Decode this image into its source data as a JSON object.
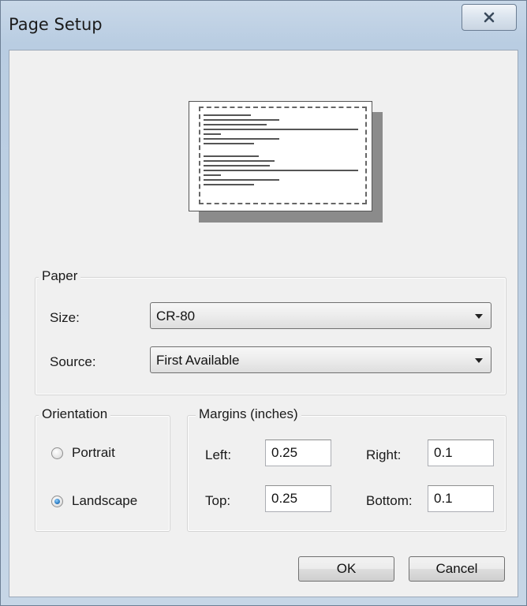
{
  "window": {
    "title": "Page Setup",
    "close_glyph": "X"
  },
  "paper": {
    "legend": "Paper",
    "size_label": "Size:",
    "size_value": "CR-80",
    "source_label": "Source:",
    "source_value": "First Available"
  },
  "orientation": {
    "legend": "Orientation",
    "options": [
      {
        "label": "Portrait",
        "selected": false
      },
      {
        "label": "Landscape",
        "selected": true
      }
    ]
  },
  "margins": {
    "legend": "Margins (inches)",
    "left_label": "Left:",
    "left_value": "0.25",
    "right_label": "Right:",
    "right_value": "0.1",
    "top_label": "Top:",
    "top_value": "0.25",
    "bottom_label": "Bottom:",
    "bottom_value": "0.1"
  },
  "buttons": {
    "ok_label": "OK",
    "cancel_label": "Cancel"
  },
  "icons": {
    "close": "close-icon",
    "dropdown": "chevron-down-icon"
  }
}
